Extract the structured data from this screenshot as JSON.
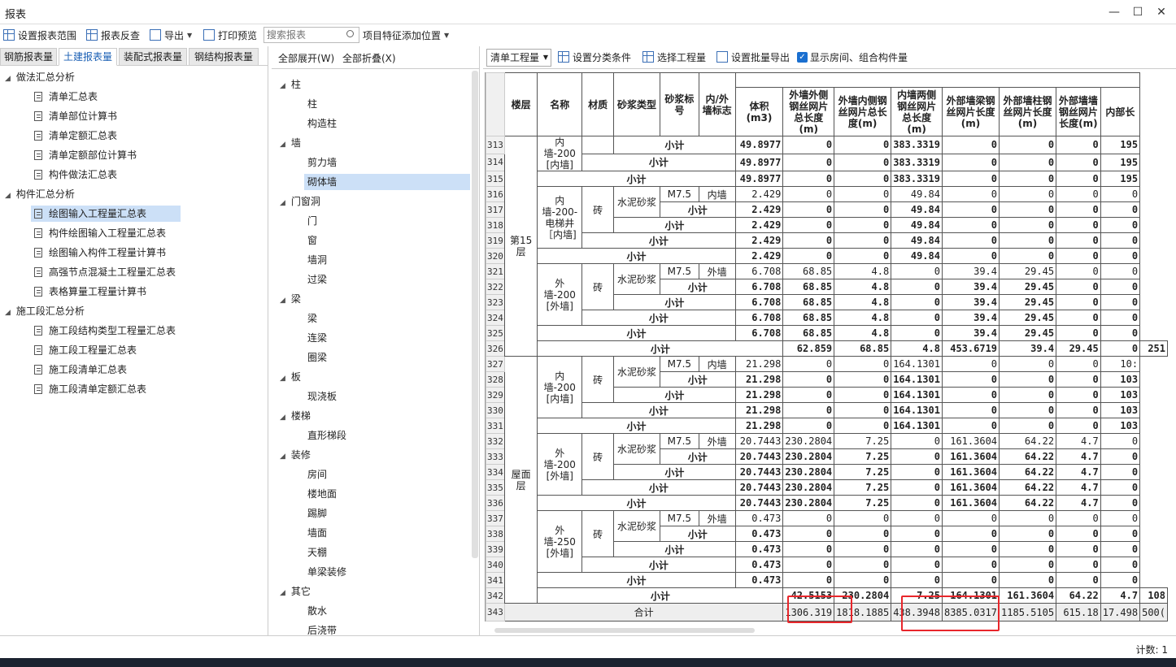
{
  "window": {
    "title": "报表",
    "minimize": "—",
    "maximize": "☐",
    "close": "✕"
  },
  "toolbar": {
    "set_range": "设置报表范围",
    "reverse_check": "报表反查",
    "export": "导出",
    "print_preview": "打印预览",
    "search_placeholder": "搜索报表",
    "feature_position": "项目特征添加位置"
  },
  "left_tabs": [
    "钢筋报表量",
    "土建报表量",
    "装配式报表量",
    "钢结构报表量"
  ],
  "left_tree": [
    {
      "label": "做法汇总分析",
      "group": true
    },
    {
      "label": "清单汇总表"
    },
    {
      "label": "清单部位计算书"
    },
    {
      "label": "清单定额汇总表"
    },
    {
      "label": "清单定额部位计算书"
    },
    {
      "label": "构件做法汇总表"
    },
    {
      "label": "构件汇总分析",
      "group": true
    },
    {
      "label": "绘图输入工程量汇总表",
      "selected": true
    },
    {
      "label": "构件绘图输入工程量汇总表"
    },
    {
      "label": "绘图输入构件工程量计算书"
    },
    {
      "label": "高强节点混凝土工程量汇总表"
    },
    {
      "label": "表格算量工程量计算书"
    },
    {
      "label": "施工段汇总分析",
      "group": true
    },
    {
      "label": "施工段结构类型工程量汇总表"
    },
    {
      "label": "施工段工程量汇总表"
    },
    {
      "label": "施工段清单汇总表"
    },
    {
      "label": "施工段清单定额汇总表"
    }
  ],
  "mid": {
    "expand_all": "全部展开(W)",
    "collapse_all": "全部折叠(X)",
    "tree": [
      {
        "label": "柱",
        "group": true
      },
      {
        "label": "柱"
      },
      {
        "label": "构造柱"
      },
      {
        "label": "墙",
        "group": true
      },
      {
        "label": "剪力墙"
      },
      {
        "label": "砌体墙",
        "selected": true
      },
      {
        "label": "门窗洞",
        "group": true
      },
      {
        "label": "门"
      },
      {
        "label": "窗"
      },
      {
        "label": "墙洞"
      },
      {
        "label": "过梁"
      },
      {
        "label": "梁",
        "group": true
      },
      {
        "label": "梁"
      },
      {
        "label": "连梁"
      },
      {
        "label": "圈梁"
      },
      {
        "label": "板",
        "group": true
      },
      {
        "label": "现浇板"
      },
      {
        "label": "楼梯",
        "group": true
      },
      {
        "label": "直形梯段"
      },
      {
        "label": "装修",
        "group": true
      },
      {
        "label": "房间"
      },
      {
        "label": "楼地面"
      },
      {
        "label": "踢脚"
      },
      {
        "label": "墙面"
      },
      {
        "label": "天棚"
      },
      {
        "label": "单梁装修"
      },
      {
        "label": "其它",
        "group": true
      },
      {
        "label": "散水"
      },
      {
        "label": "后浇带"
      }
    ]
  },
  "right_toolbar": {
    "select_value": "清单工程量",
    "set_category": "设置分类条件",
    "select_project": "选择工程量",
    "batch_export": "设置批量导出",
    "show_rooms": "显示房间、组合构件量"
  },
  "table": {
    "headers": [
      "楼层",
      "名称",
      "材质",
      "砂浆类型",
      "砂浆标号",
      "内/外墙标志",
      "体积(m3)",
      "外墙外侧钢丝网片总长度(m)",
      "外墙内侧钢丝网片总长度(m)",
      "内墙两侧钢丝网片总长度(m)",
      "外部墙梁钢丝网片长度(m)",
      "外部墙柱钢丝网片长度(m)",
      "外部墙墙钢丝网片长度(m)",
      "内部长"
    ],
    "floor15": "第15层",
    "roof": "屋面层",
    "sub": "小计",
    "total": "合计",
    "brick": "砖",
    "mortar": "水泥砂浆",
    "grade": "M7.5",
    "inner": "内墙",
    "outer": "外墙",
    "n313": "内墙-200 [内墙]",
    "n316": "内墙-200-电梯井［内墙]",
    "n321": "外墙-200 [外墙]",
    "n327": "内墙-200 [内墙]",
    "n332": "外墙-200 [外墙]",
    "n337": "外墙-250 [外墙]",
    "rows": {
      "r313": [
        "313",
        "49.8977",
        "0",
        "0",
        "383.3319",
        "0",
        "0",
        "0",
        "195"
      ],
      "r314": [
        "314",
        "49.8977",
        "0",
        "0",
        "383.3319",
        "0",
        "0",
        "0",
        "195"
      ],
      "r315": [
        "315",
        "49.8977",
        "0",
        "0",
        "383.3319",
        "0",
        "0",
        "0",
        "195"
      ],
      "r316": [
        "316",
        "2.429",
        "0",
        "0",
        "49.84",
        "0",
        "0",
        "0",
        "0"
      ],
      "r317": [
        "317",
        "2.429",
        "0",
        "0",
        "49.84",
        "0",
        "0",
        "0",
        "0"
      ],
      "r318": [
        "318",
        "2.429",
        "0",
        "0",
        "49.84",
        "0",
        "0",
        "0",
        "0"
      ],
      "r319": [
        "319",
        "2.429",
        "0",
        "0",
        "49.84",
        "0",
        "0",
        "0",
        "0"
      ],
      "r320": [
        "320",
        "2.429",
        "0",
        "0",
        "49.84",
        "0",
        "0",
        "0",
        "0"
      ],
      "r321": [
        "321",
        "6.708",
        "68.85",
        "4.8",
        "0",
        "39.4",
        "29.45",
        "0",
        "0"
      ],
      "r322": [
        "322",
        "6.708",
        "68.85",
        "4.8",
        "0",
        "39.4",
        "29.45",
        "0",
        "0"
      ],
      "r323": [
        "323",
        "6.708",
        "68.85",
        "4.8",
        "0",
        "39.4",
        "29.45",
        "0",
        "0"
      ],
      "r324": [
        "324",
        "6.708",
        "68.85",
        "4.8",
        "0",
        "39.4",
        "29.45",
        "0",
        "0"
      ],
      "r325": [
        "325",
        "6.708",
        "68.85",
        "4.8",
        "0",
        "39.4",
        "29.45",
        "0",
        "0"
      ],
      "r326": [
        "326",
        "62.859",
        "68.85",
        "4.8",
        "453.6719",
        "39.4",
        "29.45",
        "0",
        "251"
      ],
      "r327": [
        "327",
        "21.298",
        "0",
        "0",
        "164.1301",
        "0",
        "0",
        "0",
        "10:"
      ],
      "r328": [
        "328",
        "21.298",
        "0",
        "0",
        "164.1301",
        "0",
        "0",
        "0",
        "103"
      ],
      "r329": [
        "329",
        "21.298",
        "0",
        "0",
        "164.1301",
        "0",
        "0",
        "0",
        "103"
      ],
      "r330": [
        "330",
        "21.298",
        "0",
        "0",
        "164.1301",
        "0",
        "0",
        "0",
        "103"
      ],
      "r331": [
        "331",
        "21.298",
        "0",
        "0",
        "164.1301",
        "0",
        "0",
        "0",
        "103"
      ],
      "r332": [
        "332",
        "20.7443",
        "230.2804",
        "7.25",
        "0",
        "161.3604",
        "64.22",
        "4.7",
        "0"
      ],
      "r333": [
        "333",
        "20.7443",
        "230.2804",
        "7.25",
        "0",
        "161.3604",
        "64.22",
        "4.7",
        "0"
      ],
      "r334": [
        "334",
        "20.7443",
        "230.2804",
        "7.25",
        "0",
        "161.3604",
        "64.22",
        "4.7",
        "0"
      ],
      "r335": [
        "335",
        "20.7443",
        "230.2804",
        "7.25",
        "0",
        "161.3604",
        "64.22",
        "4.7",
        "0"
      ],
      "r336": [
        "336",
        "20.7443",
        "230.2804",
        "7.25",
        "0",
        "161.3604",
        "64.22",
        "4.7",
        "0"
      ],
      "r337": [
        "337",
        "0.473",
        "0",
        "0",
        "0",
        "0",
        "0",
        "0",
        "0"
      ],
      "r338": [
        "338",
        "0.473",
        "0",
        "0",
        "0",
        "0",
        "0",
        "0",
        "0"
      ],
      "r339": [
        "339",
        "0.473",
        "0",
        "0",
        "0",
        "0",
        "0",
        "0",
        "0"
      ],
      "r340": [
        "340",
        "0.473",
        "0",
        "0",
        "0",
        "0",
        "0",
        "0",
        "0"
      ],
      "r341": [
        "341",
        "0.473",
        "0",
        "0",
        "0",
        "0",
        "0",
        "0",
        "0"
      ],
      "r342": [
        "342",
        "42.5153",
        "230.2804",
        "7.25",
        "164.1301",
        "161.3604",
        "64.22",
        "4.7",
        "108"
      ],
      "r343": [
        "343",
        "1306.319",
        "1818.1885",
        "438.3948",
        "8385.0317",
        "1185.5105",
        "615.18",
        "17.498",
        "500("
      ]
    }
  },
  "status": {
    "count": "计数: 1"
  },
  "colors": {
    "highlight_box": "#e8262b",
    "accent": "#1a6fd0"
  }
}
